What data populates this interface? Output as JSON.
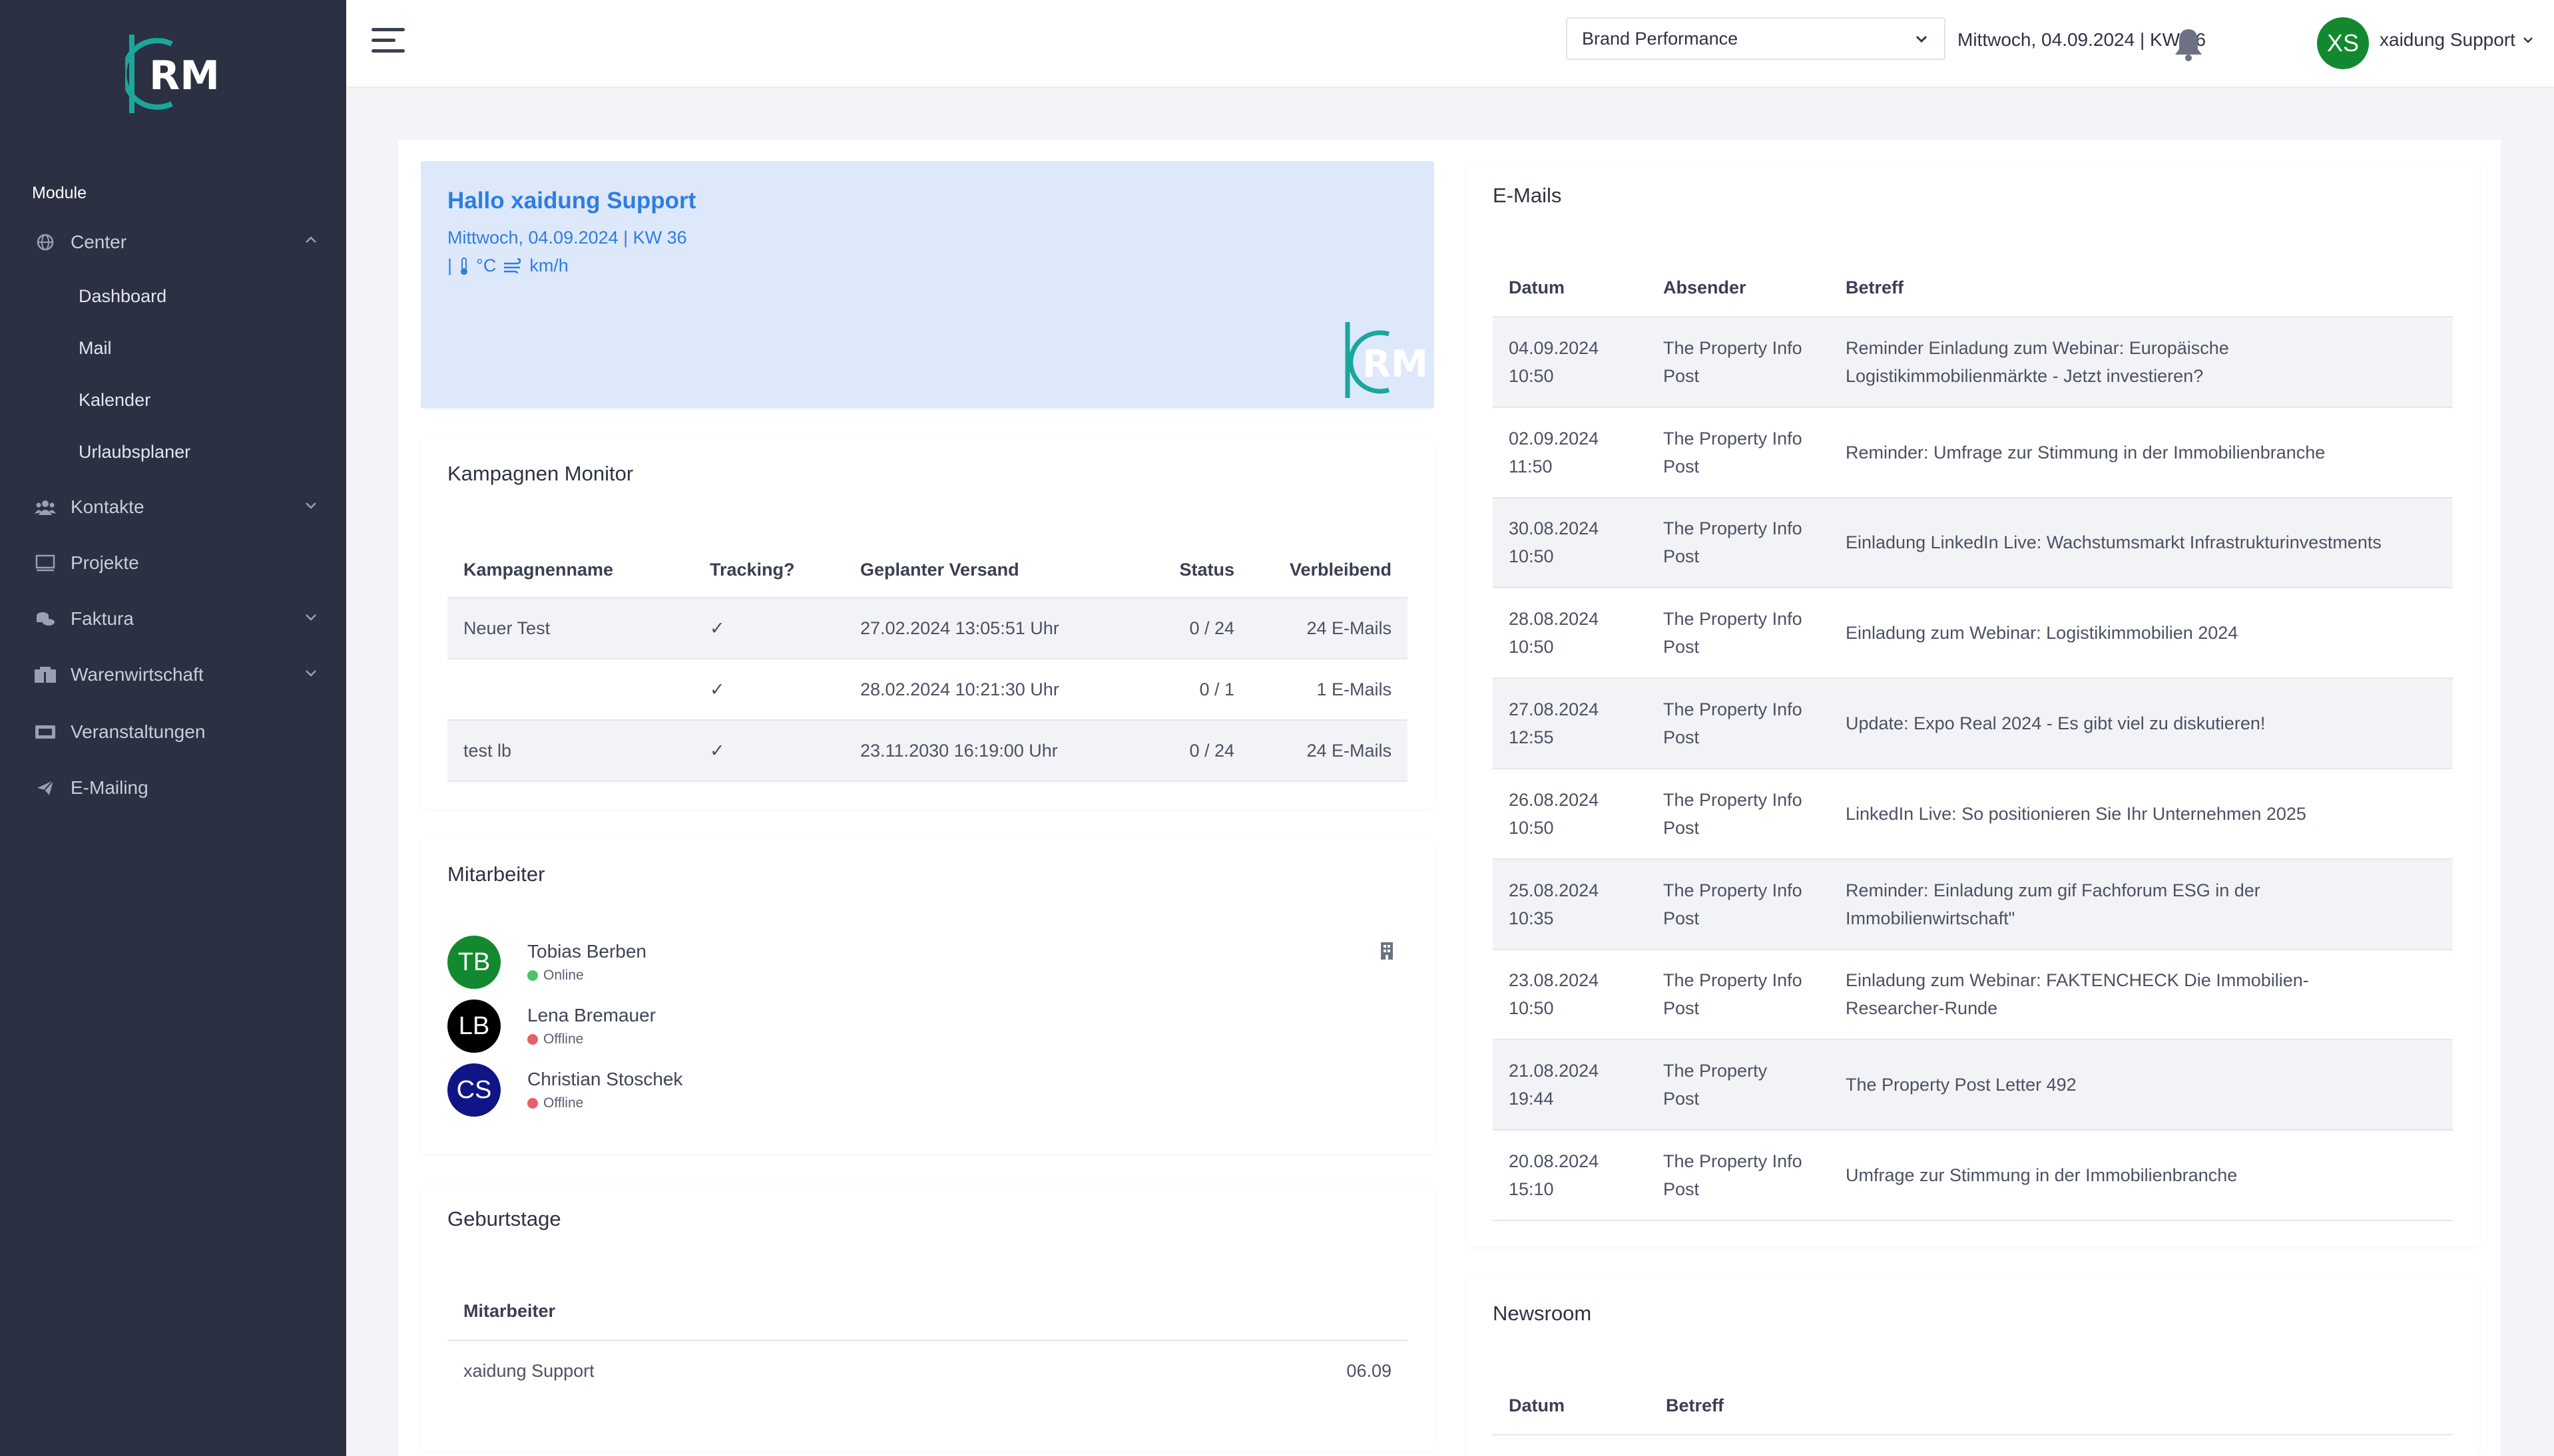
{
  "sidebar": {
    "module_title": "Module",
    "items": [
      {
        "label": "Center",
        "icon": "globe-icon",
        "expanded": true
      },
      {
        "label": "Kontakte",
        "icon": "users-icon"
      },
      {
        "label": "Projekte",
        "icon": "monitor-icon"
      },
      {
        "label": "Faktura",
        "icon": "coins-icon"
      },
      {
        "label": "Warenwirtschaft",
        "icon": "boxes-icon"
      },
      {
        "label": "Veranstaltungen",
        "icon": "ticket-icon"
      },
      {
        "label": "E-Mailing",
        "icon": "paper-plane-icon"
      }
    ],
    "sub_items": [
      "Dashboard",
      "Mail",
      "Kalender",
      "Urlaubsplaner"
    ]
  },
  "header": {
    "brand_select": "Brand Performance",
    "date": "Mittwoch, 04.09.2024 | KW 36",
    "user_initials": "XS",
    "user_name": "xaidung Support"
  },
  "welcome": {
    "title": "Hallo xaidung Support",
    "date": "Mittwoch, 04.09.2024 | KW 36",
    "temp_unit": "°C",
    "wind_unit": "km/h"
  },
  "kampagnen": {
    "title": "Kampagnen Monitor",
    "columns": [
      "Kampagnenname",
      "Tracking?",
      "Geplanter Versand",
      "Status",
      "Verbleibend"
    ],
    "rows": [
      {
        "name": "Neuer Test",
        "tracking": "✓",
        "versand": "27.02.2024 13:05:51 Uhr",
        "status": "0 / 24",
        "verbleibend": "24 E-Mails"
      },
      {
        "name": "",
        "tracking": "✓",
        "versand": "28.02.2024 10:21:30 Uhr",
        "status": "0 / 1",
        "verbleibend": "1 E-Mails"
      },
      {
        "name": "test lb",
        "tracking": "✓",
        "versand": "23.11.2030 16:19:00 Uhr",
        "status": "0 / 24",
        "verbleibend": "24 E-Mails"
      }
    ]
  },
  "mitarbeiter": {
    "title": "Mitarbeiter",
    "people": [
      {
        "initials": "TB",
        "name": "Tobias Berben",
        "status": "Online",
        "avatar_color": "#13892f",
        "status_color": "#4cc26a"
      },
      {
        "initials": "LB",
        "name": "Lena Bremauer",
        "status": "Offline",
        "avatar_color": "#000000",
        "status_color": "#e4606c"
      },
      {
        "initials": "CS",
        "name": "Christian Stoschek",
        "status": "Offline",
        "avatar_color": "#0f1586",
        "status_color": "#e4606c"
      }
    ]
  },
  "geburtstage": {
    "title": "Geburtstage",
    "column": "Mitarbeiter",
    "rows": [
      {
        "name": "xaidung Support",
        "date": "06.09"
      }
    ]
  },
  "emails": {
    "title": "E-Mails",
    "columns": [
      "Datum",
      "Absender",
      "Betreff"
    ],
    "rows": [
      {
        "date": "04.09.2024",
        "time": "10:50",
        "sender1": "The Property Info",
        "sender2": "Post",
        "subject1": "Reminder Einladung zum Webinar: Europäische",
        "subject2": "Logistikimmobilienmärkte - Jetzt investieren?"
      },
      {
        "date": "02.09.2024",
        "time": "11:50",
        "sender1": "The Property Info",
        "sender2": "Post",
        "subject1": "Reminder: Umfrage zur Stimmung in der Immobilienbranche",
        "subject2": ""
      },
      {
        "date": "30.08.2024",
        "time": "10:50",
        "sender1": "The Property Info",
        "sender2": "Post",
        "subject1": "Einladung LinkedIn Live: Wachstumsmarkt Infrastrukturinvestments",
        "subject2": ""
      },
      {
        "date": "28.08.2024",
        "time": "10:50",
        "sender1": "The Property Info",
        "sender2": "Post",
        "subject1": "Einladung zum Webinar: Logistikimmobilien 2024",
        "subject2": ""
      },
      {
        "date": "27.08.2024",
        "time": "12:55",
        "sender1": "The Property Info",
        "sender2": "Post",
        "subject1": "Update: Expo Real 2024 - Es gibt viel zu diskutieren!",
        "subject2": ""
      },
      {
        "date": "26.08.2024",
        "time": "10:50",
        "sender1": "The Property Info",
        "sender2": "Post",
        "subject1": "LinkedIn Live: So positionieren Sie Ihr Unternehmen 2025",
        "subject2": ""
      },
      {
        "date": "25.08.2024",
        "time": "10:35",
        "sender1": "The Property Info",
        "sender2": "Post",
        "subject1": "Reminder: Einladung zum gif Fachforum ESG in der",
        "subject2": "Immobilienwirtschaft\""
      },
      {
        "date": "23.08.2024",
        "time": "10:50",
        "sender1": "The Property Info",
        "sender2": "Post",
        "subject1": "Einladung zum Webinar: FAKTENCHECK  Die Immobilien-",
        "subject2": "Researcher-Runde"
      },
      {
        "date": "21.08.2024",
        "time": "19:44",
        "sender1": "The Property",
        "sender2": "Post",
        "subject1": "The Property Post Letter 492",
        "subject2": ""
      },
      {
        "date": "20.08.2024",
        "time": "15:10",
        "sender1": "The Property Info",
        "sender2": "Post",
        "subject1": "Umfrage zur Stimmung in der Immobilienbranche",
        "subject2": ""
      }
    ]
  },
  "newsroom": {
    "title": "Newsroom",
    "columns": [
      "Datum",
      "Betreff"
    ]
  },
  "colors": {
    "sidebar_bg": "#2b3043",
    "accent_teal": "#1aa79b",
    "welcome_bg": "#dde8fb",
    "welcome_text": "#2f7de1"
  }
}
